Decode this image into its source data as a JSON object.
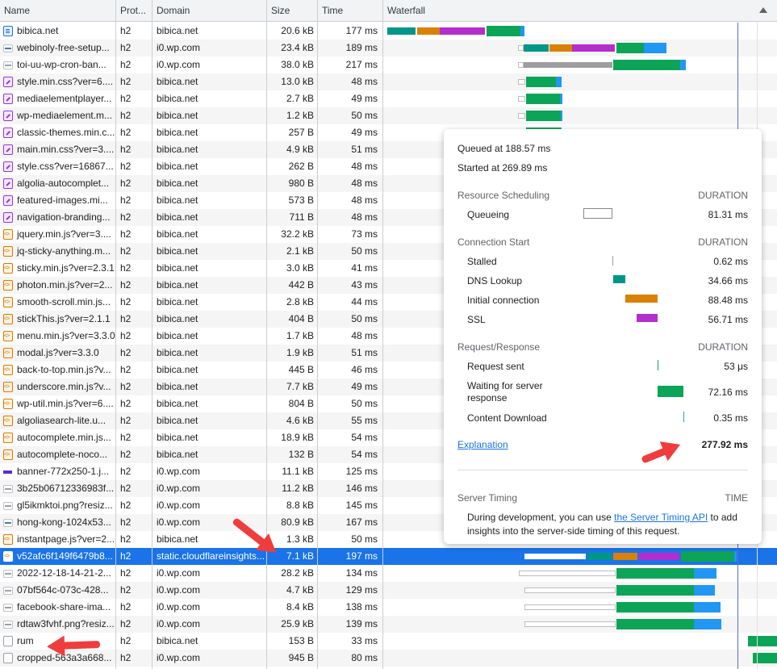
{
  "columns": {
    "name": "Name",
    "protocol": "Prot...",
    "domain": "Domain",
    "size": "Size",
    "time": "Time",
    "waterfall": "Waterfall"
  },
  "colors": {
    "dns": "#009688",
    "connect": "#d98100",
    "ssl": "#b52dcd",
    "waiting": "#0ca456",
    "download": "#2196f3",
    "stalled": "#9e9e9e",
    "selected": "#1a73e8"
  },
  "rows": [
    {
      "icon": "doc-icon",
      "name": "bibica.net",
      "protocol": "h2",
      "domain": "bibica.net",
      "size": "20.6 kB",
      "time": "177 ms"
    },
    {
      "icon": "image-icon",
      "name": "webinoly-free-setup...",
      "protocol": "h2",
      "domain": "i0.wp.com",
      "size": "23.4 kB",
      "time": "189 ms"
    },
    {
      "icon": "image-icon",
      "name": "toi-uu-wp-cron-ban...",
      "protocol": "h2",
      "domain": "i0.wp.com",
      "size": "38.0 kB",
      "time": "217 ms"
    },
    {
      "icon": "css-icon",
      "name": "style.min.css?ver=6....",
      "protocol": "h2",
      "domain": "bibica.net",
      "size": "13.0 kB",
      "time": "48 ms"
    },
    {
      "icon": "css-icon",
      "name": "mediaelementplayer...",
      "protocol": "h2",
      "domain": "bibica.net",
      "size": "2.7 kB",
      "time": "49 ms"
    },
    {
      "icon": "css-icon",
      "name": "wp-mediaelement.m...",
      "protocol": "h2",
      "domain": "bibica.net",
      "size": "1.2 kB",
      "time": "50 ms"
    },
    {
      "icon": "css-icon",
      "name": "classic-themes.min.c...",
      "protocol": "h2",
      "domain": "bibica.net",
      "size": "257 B",
      "time": "49 ms"
    },
    {
      "icon": "css-icon",
      "name": "main.min.css?ver=3....",
      "protocol": "h2",
      "domain": "bibica.net",
      "size": "4.9 kB",
      "time": "51 ms"
    },
    {
      "icon": "css-icon",
      "name": "style.css?ver=16867...",
      "protocol": "h2",
      "domain": "bibica.net",
      "size": "262 B",
      "time": "48 ms"
    },
    {
      "icon": "css-icon",
      "name": "algolia-autocomplet...",
      "protocol": "h2",
      "domain": "bibica.net",
      "size": "980 B",
      "time": "48 ms"
    },
    {
      "icon": "css-icon",
      "name": "featured-images.mi...",
      "protocol": "h2",
      "domain": "bibica.net",
      "size": "573 B",
      "time": "48 ms"
    },
    {
      "icon": "css-icon",
      "name": "navigation-branding...",
      "protocol": "h2",
      "domain": "bibica.net",
      "size": "711 B",
      "time": "48 ms"
    },
    {
      "icon": "js-icon",
      "name": "jquery.min.js?ver=3....",
      "protocol": "h2",
      "domain": "bibica.net",
      "size": "32.2 kB",
      "time": "73 ms"
    },
    {
      "icon": "js-icon",
      "name": "jq-sticky-anything.m...",
      "protocol": "h2",
      "domain": "bibica.net",
      "size": "2.1 kB",
      "time": "50 ms"
    },
    {
      "icon": "js-icon",
      "name": "sticky.min.js?ver=2.3.1",
      "protocol": "h2",
      "domain": "bibica.net",
      "size": "3.0 kB",
      "time": "41 ms"
    },
    {
      "icon": "js-icon",
      "name": "photon.min.js?ver=2...",
      "protocol": "h2",
      "domain": "bibica.net",
      "size": "442 B",
      "time": "43 ms"
    },
    {
      "icon": "js-icon",
      "name": "smooth-scroll.min.js...",
      "protocol": "h2",
      "domain": "bibica.net",
      "size": "2.8 kB",
      "time": "44 ms"
    },
    {
      "icon": "js-icon",
      "name": "stickThis.js?ver=2.1.1",
      "protocol": "h2",
      "domain": "bibica.net",
      "size": "404 B",
      "time": "50 ms"
    },
    {
      "icon": "js-icon",
      "name": "menu.min.js?ver=3.3.0",
      "protocol": "h2",
      "domain": "bibica.net",
      "size": "1.7 kB",
      "time": "48 ms"
    },
    {
      "icon": "js-icon",
      "name": "modal.js?ver=3.3.0",
      "protocol": "h2",
      "domain": "bibica.net",
      "size": "1.9 kB",
      "time": "51 ms"
    },
    {
      "icon": "js-icon",
      "name": "back-to-top.min.js?v...",
      "protocol": "h2",
      "domain": "bibica.net",
      "size": "445 B",
      "time": "46 ms"
    },
    {
      "icon": "js-icon",
      "name": "underscore.min.js?v...",
      "protocol": "h2",
      "domain": "bibica.net",
      "size": "7.7 kB",
      "time": "49 ms"
    },
    {
      "icon": "js-icon",
      "name": "wp-util.min.js?ver=6....",
      "protocol": "h2",
      "domain": "bibica.net",
      "size": "804 B",
      "time": "50 ms"
    },
    {
      "icon": "js-icon",
      "name": "algoliasearch-lite.u...",
      "protocol": "h2",
      "domain": "bibica.net",
      "size": "4.6 kB",
      "time": "55 ms"
    },
    {
      "icon": "js-icon",
      "name": "autocomplete.min.js...",
      "protocol": "h2",
      "domain": "bibica.net",
      "size": "18.9 kB",
      "time": "54 ms"
    },
    {
      "icon": "js-icon",
      "name": "autocomplete-noco...",
      "protocol": "h2",
      "domain": "bibica.net",
      "size": "132 B",
      "time": "54 ms"
    },
    {
      "icon": "banner-icon",
      "name": "banner-772x250-1.j...",
      "protocol": "h2",
      "domain": "i0.wp.com",
      "size": "11.1 kB",
      "time": "125 ms"
    },
    {
      "icon": "image-icon",
      "name": "3b25b06712336983f...",
      "protocol": "h2",
      "domain": "i0.wp.com",
      "size": "11.2 kB",
      "time": "146 ms"
    },
    {
      "icon": "image-icon",
      "name": "gl5ikmktoi.png?resiz...",
      "protocol": "h2",
      "domain": "i0.wp.com",
      "size": "8.8 kB",
      "time": "145 ms"
    },
    {
      "icon": "image-icon",
      "name": "hong-kong-1024x53...",
      "protocol": "h2",
      "domain": "i0.wp.com",
      "size": "80.9 kB",
      "time": "167 ms"
    },
    {
      "icon": "js-icon",
      "name": "instantpage.js?ver=2...",
      "protocol": "h2",
      "domain": "bibica.net",
      "size": "1.3 kB",
      "time": "50 ms"
    },
    {
      "icon": "js-icon",
      "name": "v52afc6f149f6479b8...",
      "protocol": "h2",
      "domain": "static.cloudflareinsights...",
      "size": "7.1 kB",
      "time": "197 ms",
      "selected": true
    },
    {
      "icon": "image-icon",
      "name": "2022-12-18-14-21-2...",
      "protocol": "h2",
      "domain": "i0.wp.com",
      "size": "28.2 kB",
      "time": "134 ms"
    },
    {
      "icon": "image-icon",
      "name": "07bf564c-073c-428...",
      "protocol": "h2",
      "domain": "i0.wp.com",
      "size": "4.7 kB",
      "time": "129 ms"
    },
    {
      "icon": "image-icon",
      "name": "facebook-share-ima...",
      "protocol": "h2",
      "domain": "i0.wp.com",
      "size": "8.4 kB",
      "time": "138 ms"
    },
    {
      "icon": "image-icon",
      "name": "rdtaw3fvhf.png?resiz...",
      "protocol": "h2",
      "domain": "i0.wp.com",
      "size": "25.9 kB",
      "time": "139 ms"
    },
    {
      "icon": "other-icon",
      "name": "rum",
      "protocol": "h2",
      "domain": "bibica.net",
      "size": "153 B",
      "time": "33 ms"
    },
    {
      "icon": "other-icon",
      "name": "cropped-563a3a668...",
      "protocol": "h2",
      "domain": "i0.wp.com",
      "size": "945 B",
      "time": "80 ms"
    }
  ],
  "timing_popup": {
    "queued_at": "Queued at 188.57 ms",
    "started_at": "Started at 269.89 ms",
    "resource_scheduling": "Resource Scheduling",
    "connection_start": "Connection Start",
    "request_response": "Request/Response",
    "duration_label": "DURATION",
    "queueing_label": "Queueing",
    "queueing_value": "81.31 ms",
    "stalled_label": "Stalled",
    "stalled_value": "0.62 ms",
    "dns_label": "DNS Lookup",
    "dns_value": "34.66 ms",
    "initial_label": "Initial connection",
    "initial_value": "88.48 ms",
    "ssl_label": "SSL",
    "ssl_value": "56.71 ms",
    "request_sent_label": "Request sent",
    "request_sent_value": "53 μs",
    "waiting_label": "Waiting for server response",
    "waiting_value": "72.16 ms",
    "download_label": "Content Download",
    "download_value": "0.35 ms",
    "explanation": "Explanation",
    "total": "277.92 ms",
    "server_timing": "Server Timing",
    "time_label": "TIME",
    "server_text_before": "During development, you can use ",
    "server_link": "the Server Timing API",
    "server_text_after": " to add insights into the server-side timing of this request."
  }
}
